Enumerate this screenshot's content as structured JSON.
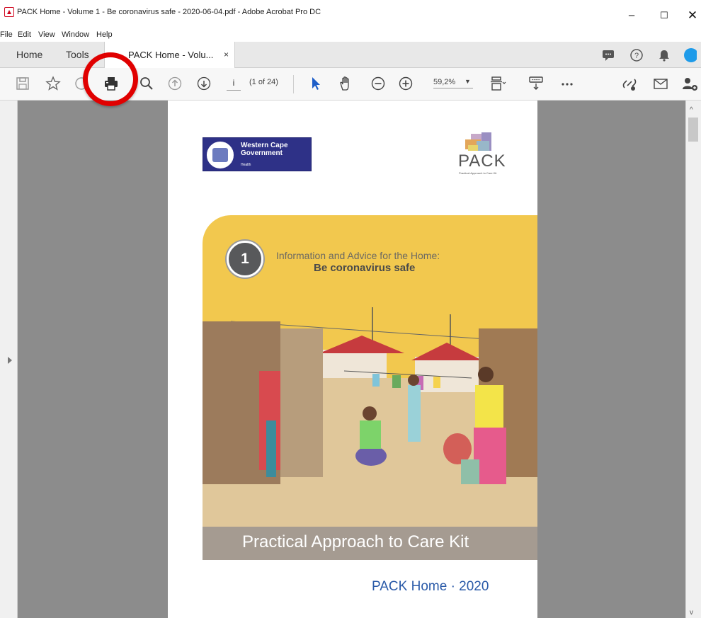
{
  "window": {
    "title": "PACK Home - Volume  1 - Be coronavirus safe - 2020-06-04.pdf - Adobe Acrobat Pro DC",
    "minimize": "–",
    "maximize": "☐",
    "close": "✕"
  },
  "menu": [
    "File",
    "Edit",
    "View",
    "Window",
    "Help"
  ],
  "tabs": {
    "home": "Home",
    "tools": "Tools",
    "document": "PACK Home - Volu...",
    "close": "×"
  },
  "toolbar": {
    "page_current": "i",
    "page_of": "(1 of 24)",
    "zoom": "59,2%",
    "icons": [
      "save-icon",
      "bookmark-star-icon",
      "upload-icon",
      "print-icon",
      "zoom-search-icon",
      "page-up-icon",
      "page-down-icon",
      "select-pointer-icon",
      "hand-icon",
      "zoom-out-icon",
      "zoom-in-icon",
      "fit-page-icon",
      "keyboard-icon",
      "more-icon",
      "share-link-icon",
      "email-icon",
      "add-user-icon"
    ]
  },
  "document": {
    "org_line1": "Western Cape",
    "org_line2": "Government",
    "org_line3": "Health",
    "pack_logo": "PACK",
    "pack_sub": "Practical Approach to Care Kit",
    "volume_number": "1",
    "cover_line1": "Information and Advice for the Home:",
    "cover_line2": "Be coronavirus safe",
    "band_title": "Practical Approach to Care Kit",
    "footer": "PACK Home · 2020"
  },
  "colors": {
    "annotation_ring": "#e00000",
    "cover_yellow": "#f2c84e",
    "band_taupe": "#a59b91",
    "wcg_blue": "#2e3187",
    "footer_blue": "#2a5aa8"
  }
}
